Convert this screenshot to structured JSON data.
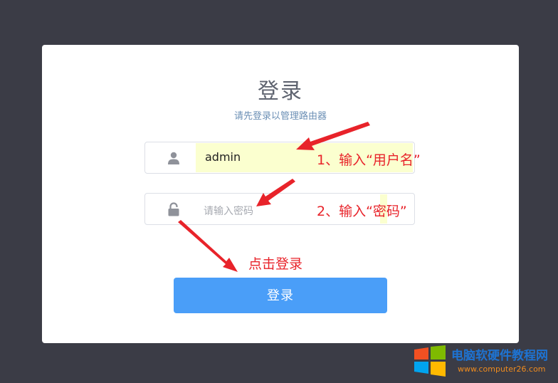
{
  "login": {
    "title": "登录",
    "subtitle": "请先登录以管理路由器",
    "username": {
      "value": "admin"
    },
    "password": {
      "placeholder": "请输入密码"
    },
    "submit_label": "登录"
  },
  "annotations": {
    "step1": "1、输入“用户名”",
    "step2": "2、输入“密码”",
    "step3": "点击登录"
  },
  "watermark": {
    "name": "电脑软硬件教程网",
    "url": "www.computer26.com"
  },
  "icons": {
    "user": "user-icon",
    "lock": "lock-icon"
  },
  "colors": {
    "background": "#3b3c46",
    "button": "#4a9ef8",
    "annotation": "#e8232a",
    "autofill": "#fbffcf"
  }
}
